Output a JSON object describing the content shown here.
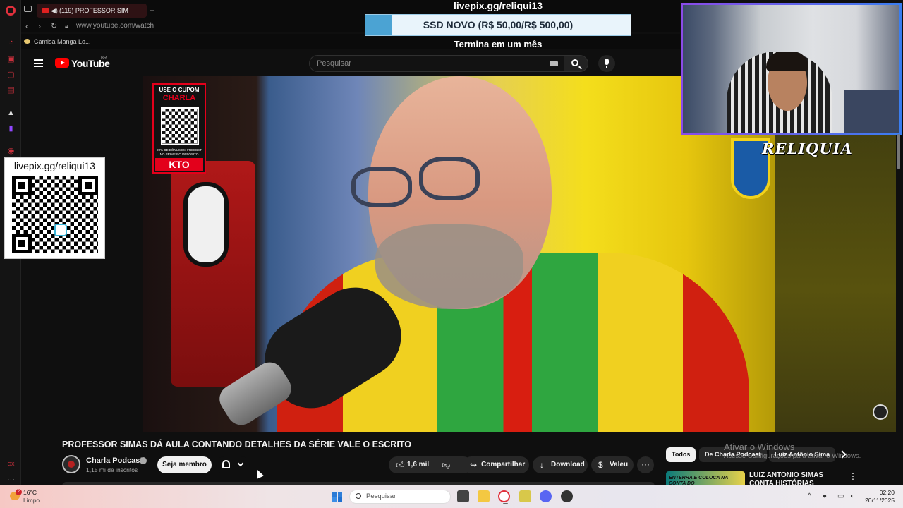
{
  "browser": {
    "tab_title": "(119) PROFESSOR SIM",
    "new_tab": "+",
    "url": "www.youtube.com/watch",
    "bookmark": "Camisa Manga Lo..."
  },
  "goal_overlay": {
    "title": "livepix.gg/reliqui13",
    "bar_text": "SSD NOVO (R$ 50,00/R$ 500,00)",
    "progress": 0.1,
    "subtitle": "Termina em um mês"
  },
  "youtube": {
    "wordmark": "YouTube",
    "country": "BR",
    "search_placeholder": "Pesquisar"
  },
  "video": {
    "coupon_head": "USE O CUPOM",
    "coupon_code": "CHARLA",
    "coupon_small": "20% DE BÔNUS EM FREEBET NO PRIMEIRO DEPÓSITO",
    "coupon_brand": "KTO"
  },
  "qr_card": {
    "label": "livepix.gg/reliqui13"
  },
  "stream_tag": "RELIQUIA",
  "info": {
    "title": "PROFESSOR SIMAS DÁ AULA CONTANDO DETALHES DA SÉRIE VALE O ESCRITO",
    "channel": "Charla Podcast",
    "subscribers": "1,15 mi de inscritos",
    "join": "Seja membro",
    "likes": "1,6 mil",
    "share": "Compartilhar",
    "download": "Download",
    "thanks": "Valeu",
    "more": "···"
  },
  "chips": [
    "Todos",
    "De Charla Podcast",
    "Luiz Antônio Sima"
  ],
  "related": {
    "thumb_text": "ENTERRA E COLOCA NA CONTA DO",
    "title": "LUIZ ANTONIO SIMAS CONTA HISTÓRIAS GENIAIS DA"
  },
  "watermark": {
    "line1": "Ativar o Windows",
    "line2": "Acesse Configurações para ativar o Windows."
  },
  "taskbar": {
    "notif_count": "2",
    "temperature": "16°C",
    "condition": "Limpo",
    "search": "Pesquisar",
    "time": "02:20",
    "date": "20/11/2025"
  },
  "colors": {
    "youtube_red": "#ff0000",
    "goal_fill": "#4ba3d3",
    "kto_red": "#e3001b",
    "opera_red": "#e0303c"
  },
  "icons": [
    "opera-logo",
    "hamburger-icon",
    "search-icon",
    "mic-icon",
    "bell-icon",
    "like-icon",
    "dislike-icon",
    "share-icon",
    "download-icon",
    "thanks-icon",
    "windows-start-icon"
  ]
}
